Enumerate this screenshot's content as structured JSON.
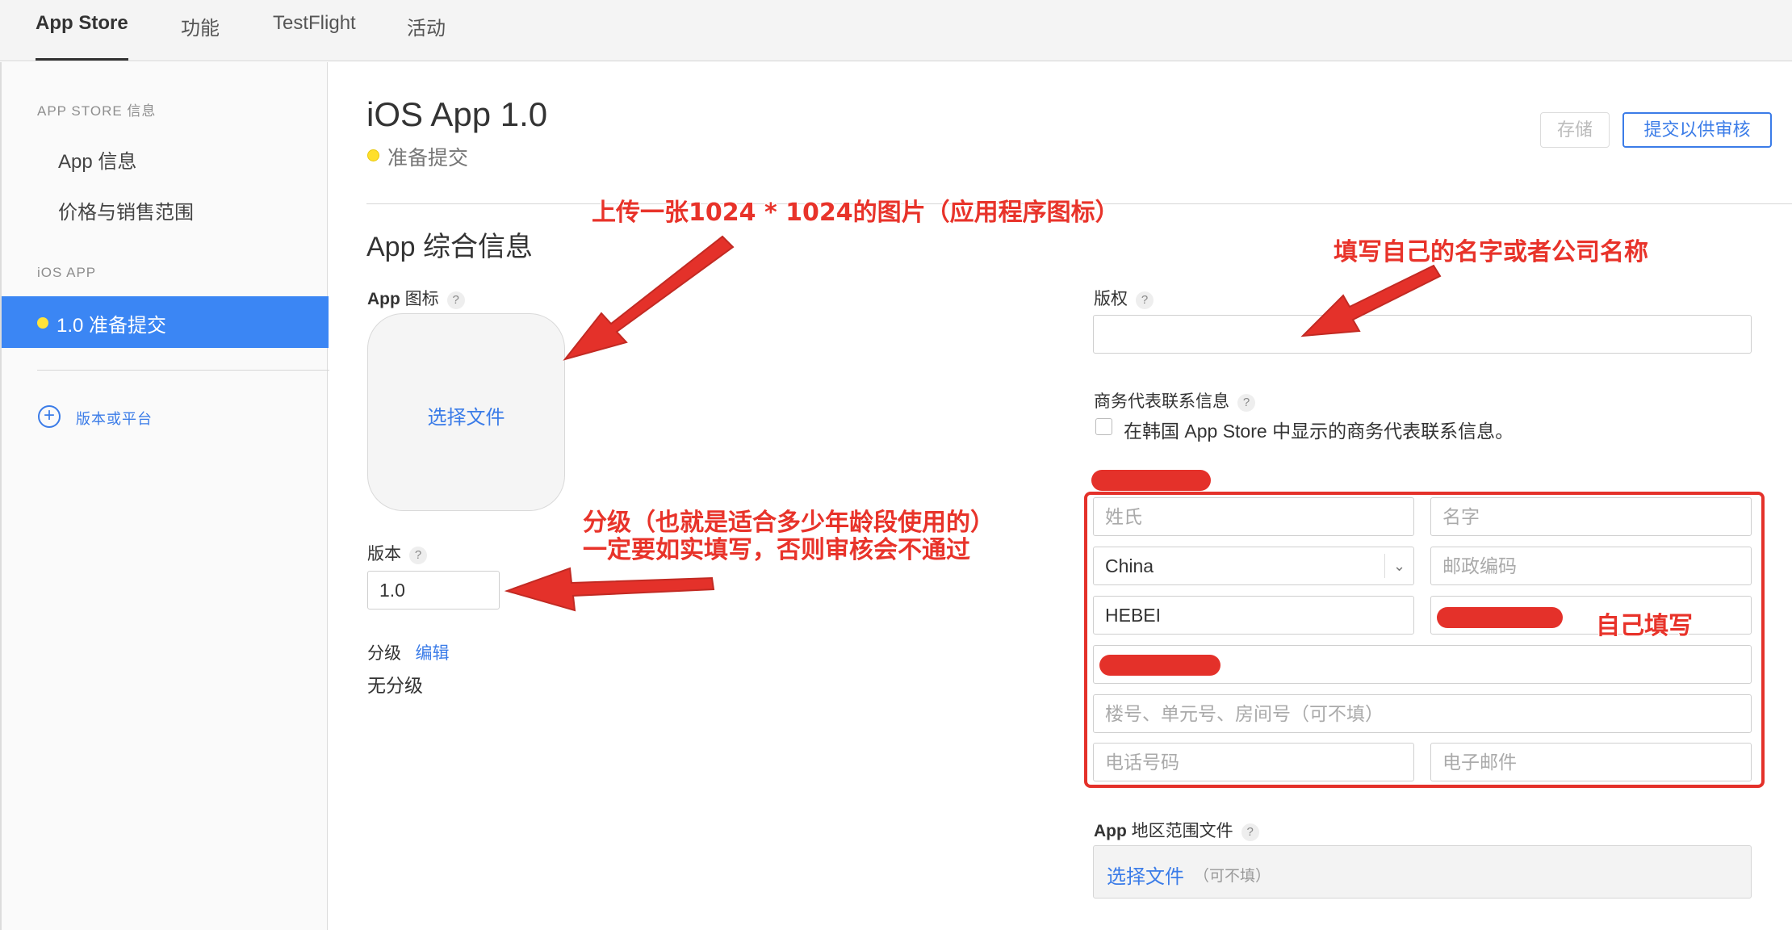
{
  "topbar": {
    "tabs": [
      {
        "label": "App Store"
      },
      {
        "label": "功能"
      },
      {
        "label": "TestFlight"
      },
      {
        "label": "活动"
      }
    ]
  },
  "sidebar": {
    "heading_store": "APP STORE 信息",
    "items": [
      {
        "label": "App 信息"
      },
      {
        "label": "价格与销售范围"
      }
    ],
    "heading_ios": "iOS APP",
    "active_item": "1.0 准备提交",
    "add_label": "版本或平台"
  },
  "main": {
    "title": "iOS App 1.0",
    "status": "准备提交",
    "save_label": "存储",
    "submit_label": "提交以供审核",
    "section_title": "App 综合信息",
    "icon_label_bold": "App",
    "icon_label": "图标",
    "choose_file": "选择文件",
    "version_label": "版本",
    "version_value": "1.0",
    "rating_label": "分级",
    "rating_edit": "编辑",
    "rating_value": "无分级",
    "copyright_label": "版权",
    "copyright_value": "",
    "contact_label": "商务代表联系信息",
    "contact_checkbox_label": "在韩国 App Store 中显示的商务代表联系信息。",
    "fields": {
      "last_name_placeholder": "姓氏",
      "first_name_placeholder": "名字",
      "country_value": "China",
      "postal_placeholder": "邮政编码",
      "province_value": "HEBEI",
      "address2_placeholder": "楼号、单元号、房间号（可不填）",
      "phone_placeholder": "电话号码",
      "email_placeholder": "电子邮件"
    },
    "region_label_bold": "App",
    "region_label": "地区范围文件",
    "region_choose": "选择文件",
    "region_optional": "（可不填）"
  },
  "annotations": {
    "icon_note": "上传一张1024 * 1024的图片（应用程序图标）",
    "copyright_note": "填写自己的名字或者公司名称",
    "rating_note_1": "分级（也就是适合多少年龄段使用的）",
    "rating_note_2": "一定要如实填写，否则审核会不通过",
    "self_fill_note": "自己填写",
    "color": "#e4312a"
  }
}
